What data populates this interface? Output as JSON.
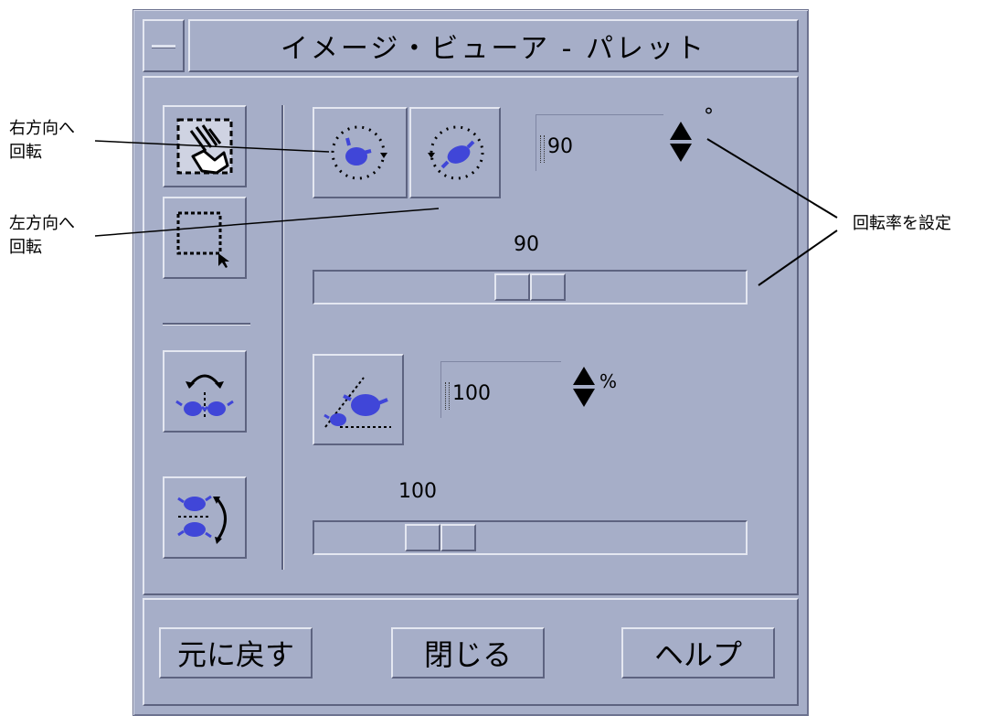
{
  "window": {
    "title": "イメージ・ビューア - パレット"
  },
  "rotate": {
    "value": "90",
    "unit": "°",
    "slider_value": "90",
    "slider_fraction": 0.5
  },
  "zoom": {
    "value": "100",
    "unit": "%",
    "slider_value": "100",
    "slider_fraction": 0.25
  },
  "buttons": {
    "reset": "元に戻す",
    "close": "閉じる",
    "help": "ヘルプ"
  },
  "callouts": {
    "rotate_right": [
      "右方向へ",
      "回転"
    ],
    "rotate_left": [
      "左方向へ",
      "回転"
    ],
    "set_rate": "回転率を設定"
  },
  "icons": {
    "pan": "hand-icon",
    "select": "selection-rectangle-icon",
    "flip_horizontal": "flip-horizontal-icon",
    "flip_vertical": "flip-vertical-icon",
    "rotate_right": "rotate-right-icon",
    "rotate_left": "rotate-left-icon",
    "zoom": "zoom-icon"
  },
  "colors": {
    "panel": "#a6aec8",
    "teapot": "#4046d8"
  }
}
